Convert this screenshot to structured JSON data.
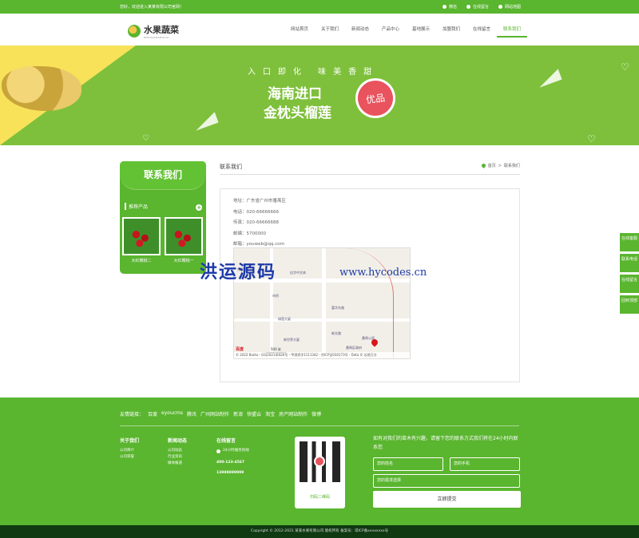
{
  "topbar": {
    "welcome": "您好，欢迎进入某某有限公司官网！",
    "links": [
      {
        "icon": "weibo-icon",
        "label": "微信"
      },
      {
        "icon": "message-icon",
        "label": "在线留言"
      },
      {
        "icon": "sitemap-icon",
        "label": "网站地图"
      }
    ]
  },
  "header": {
    "logo_title": "水果蔬菜",
    "logo_sub": "SHUIGUOSHUCAI",
    "nav": [
      "网站首页",
      "关于我们",
      "新闻动态",
      "产品中心",
      "基地展示",
      "加盟我们",
      "在线留言",
      "联系我们"
    ],
    "active_nav": "联系我们"
  },
  "banner": {
    "slogan": "入口即化 味美香甜",
    "line1": "海南进口",
    "line2": "金枕头榴莲",
    "seal": "优品"
  },
  "sidebar": {
    "title": "联系我们",
    "rec_label": "推荐产品",
    "plus": "+",
    "products": [
      "大红樱桃二",
      "大红樱桃一"
    ]
  },
  "main": {
    "title": "联系我们",
    "breadcrumb_home": "首页",
    "breadcrumb_sep": ">",
    "breadcrumb_current": "联系我们",
    "address": "地址：广东省广州市番禺区",
    "phone": "电话：020-66666666",
    "fax": "传真：020-66666688",
    "postcode": "邮编：5700000",
    "email": "邮箱：youweb@qq.com",
    "map_labels": [
      "东雅居",
      "佳华中文体",
      "市桥",
      "富华东路",
      "绿茵大厦",
      "番禺公园",
      "新世界大厦",
      "新光路",
      "番禺区政府"
    ],
    "map_scale": "500 米",
    "map_brand": "百度",
    "map_footer": "© 2022 Baidu - GS(2021)6026号 - 甲测资字1111342 - 京ICP证030173号 - Data © 长地万方"
  },
  "watermark": {
    "cn": "洪运源码",
    "url": "www.hycodes.cn"
  },
  "float_buttons": [
    "在线客服",
    "联系电话",
    "在线留言",
    "回到顶部"
  ],
  "footer": {
    "links_label": "友情链接：",
    "links": [
      "百度",
      "eyoucms",
      "腾讯",
      "广州网站制作",
      "新浪",
      "快盟云",
      "淘宝",
      "房产网站制作",
      "微博"
    ],
    "col1_title": "关于我们",
    "col1_items": [
      "公司简介",
      "公司荣誉"
    ],
    "col2_title": "新闻动态",
    "col2_items": [
      "公司动态",
      "行业资讯",
      "媒体报道"
    ],
    "col3_title": "在线留言",
    "hotline_label": "24小时服务热线",
    "phone1": "400-123-4567",
    "phone2": "13988889999",
    "qr_label": "扫码二维码",
    "form_intro": "如有对我们的苗木有兴趣，请留下您的联系方式我们将在24小时内联系您",
    "name_placeholder": "您的姓名",
    "phone_placeholder": "您的手机",
    "need_placeholder": "您的需求选择",
    "submit": "立即提交",
    "copyright": "Copyright © 2012-2021 某某水果有限公司 版权所有   备案号：琼ICP备xxxxxxxx号"
  },
  "colors": {
    "brand_green": "#5ab52f",
    "footer_dark": "#0f3a12",
    "banner_yellow": "#f7e25a",
    "seal_red": "#e8535d"
  }
}
